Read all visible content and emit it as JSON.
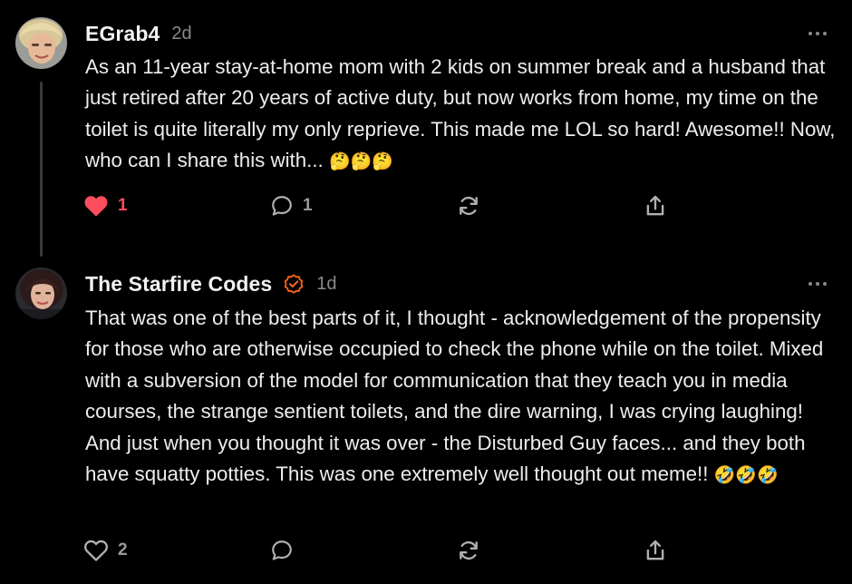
{
  "comments": [
    {
      "author": "EGrab4",
      "time": "2d",
      "text": "As an 11-year stay-at-home mom with 2 kids on summer break and a husband that just retired after 20 years of active duty, but now works from home, my time on the toilet is quite literally my only reprieve. This made me LOL so hard! Awesome!! Now, who can I share this with...",
      "emoji": "🤔🤔🤔",
      "likes": "1",
      "liked": true,
      "replies": "1",
      "verified": false
    },
    {
      "author": "The Starfire Codes",
      "time": "1d",
      "text": "That was one of the best parts of it, I thought - acknowledgement of the propensity for those who are otherwise occupied to check the phone while on the toilet. Mixed with a subversion of the model for communication that they teach you in media courses, the strange sentient toilets, and the dire warning, I was crying laughing! And just when you thought it was over - the Disturbed Guy faces... and they both have squatty potties. This was one extremely well thought out meme!!",
      "emoji": "🤣🤣🤣",
      "likes": "2",
      "liked": false,
      "replies": "",
      "verified": true
    }
  ],
  "icons": {
    "like": "heart-icon",
    "reply": "comment-bubble-icon",
    "restack": "restack-icon",
    "share": "share-icon",
    "more": "more-options-icon",
    "verified": "verified-badge-icon"
  },
  "colors": {
    "background": "#000000",
    "liked": "#ff4d5e",
    "muted": "#8a8a8a",
    "verified": "#ff6719",
    "thread_line": "#3a3a3a"
  }
}
